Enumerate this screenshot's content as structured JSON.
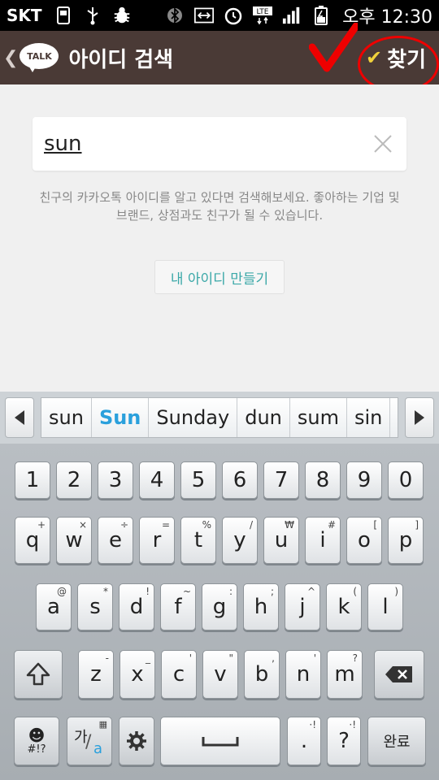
{
  "status_bar": {
    "carrier": "SKT",
    "time": "오후 12:30",
    "icons": [
      "usb-storage-icon",
      "usb-icon",
      "debug-bug-icon",
      "bluetooth-icon",
      "screen-mirror-icon",
      "alarm-icon",
      "lte-icon",
      "signal-icon",
      "battery-charging-icon"
    ]
  },
  "action_bar": {
    "logo_text": "TALK",
    "title": "아이디 검색",
    "find_label": "찾기",
    "colors": {
      "background": "#4a3a36",
      "check": "#f1d23b"
    }
  },
  "search": {
    "value": "sun",
    "hint": "친구의 카카오톡 아이디를 알고 있다면 검색해보세요. 좋아하는 기업 및 브랜드, 상점과도 친구가 될 수 있습니다.",
    "create_label": "내 아이디 만들기"
  },
  "suggestions": [
    "sun",
    "Sun",
    "Sunday",
    "dun",
    "sum",
    "sin"
  ],
  "keyboard": {
    "numbers": [
      "1",
      "2",
      "3",
      "4",
      "5",
      "6",
      "7",
      "8",
      "9",
      "0"
    ],
    "row1": [
      {
        "k": "q",
        "s": "+"
      },
      {
        "k": "w",
        "s": "×"
      },
      {
        "k": "e",
        "s": "÷"
      },
      {
        "k": "r",
        "s": "="
      },
      {
        "k": "t",
        "s": "%"
      },
      {
        "k": "y",
        "s": "/"
      },
      {
        "k": "u",
        "s": "₩"
      },
      {
        "k": "i",
        "s": "#"
      },
      {
        "k": "o",
        "s": "["
      },
      {
        "k": "p",
        "s": "]"
      }
    ],
    "row2": [
      {
        "k": "a",
        "s": "@"
      },
      {
        "k": "s",
        "s": "*"
      },
      {
        "k": "d",
        "s": "!"
      },
      {
        "k": "f",
        "s": "~"
      },
      {
        "k": "g",
        "s": ":"
      },
      {
        "k": "h",
        "s": ";"
      },
      {
        "k": "j",
        "s": "^"
      },
      {
        "k": "k",
        "s": "("
      },
      {
        "k": "l",
        "s": ")"
      }
    ],
    "row3": [
      {
        "k": "z",
        "s": "-"
      },
      {
        "k": "x",
        "s": "_"
      },
      {
        "k": "c",
        "s": "'"
      },
      {
        "k": "v",
        "s": "\""
      },
      {
        "k": "b",
        "s": ","
      },
      {
        "k": "n",
        "s": "'"
      },
      {
        "k": "m",
        "s": "?"
      }
    ],
    "symbols_label": "#!?",
    "lang_label": "가",
    "lang_sub": "a",
    "period": ".",
    "period_sec": "·!",
    "question": "?",
    "question_sec": "·!",
    "done_label": "완료",
    "colors": {
      "accent": "#2aa0dc"
    }
  }
}
